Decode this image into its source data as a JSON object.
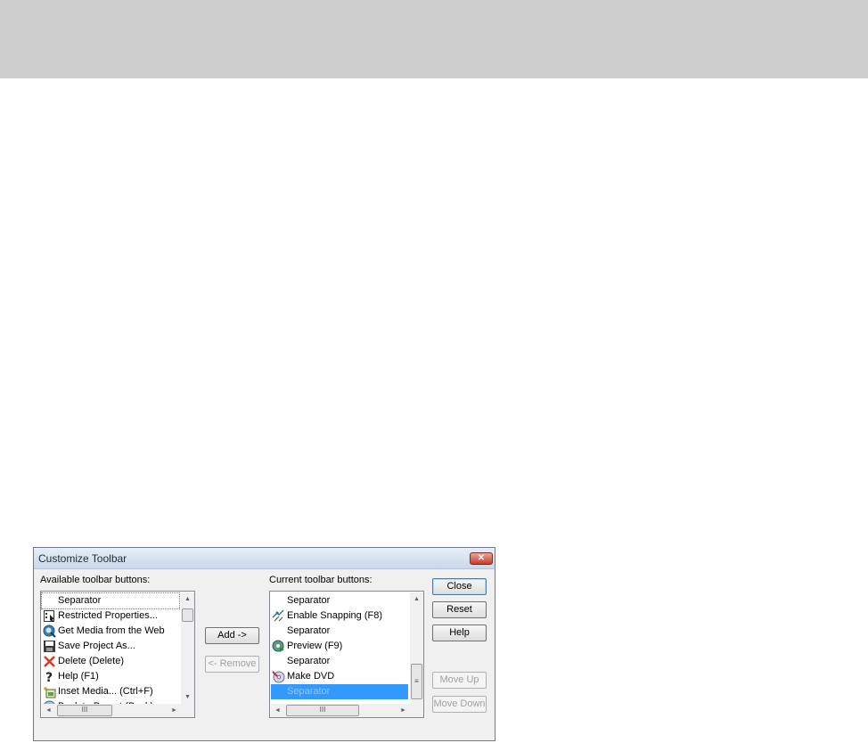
{
  "dialog": {
    "title": "Customize Toolbar",
    "close_glyph": "✕",
    "available_label": "Available toolbar buttons:",
    "current_label": "Current toolbar buttons:",
    "available_items": [
      {
        "label": "Separator",
        "icon": "none"
      },
      {
        "label": "Restricted Properties...",
        "icon": "properties-icon"
      },
      {
        "label": "Get Media from the Web",
        "icon": "web-media-icon"
      },
      {
        "label": "Save Project As...",
        "icon": "save-icon"
      },
      {
        "label": "Delete (Delete)",
        "icon": "delete-icon"
      },
      {
        "label": "Help (F1)",
        "icon": "help-icon"
      },
      {
        "label": "Inset Media... (Ctrl+F)",
        "icon": "insert-media-icon"
      },
      {
        "label": "Back to Parent (Back)",
        "icon": "back-to-parent-icon"
      }
    ],
    "current_items": [
      {
        "label": "Separator",
        "icon": "none"
      },
      {
        "label": "Enable Snapping (F8)",
        "icon": "snapping-icon"
      },
      {
        "label": "Separator",
        "icon": "none"
      },
      {
        "label": "Preview (F9)",
        "icon": "preview-icon"
      },
      {
        "label": "Separator",
        "icon": "none"
      },
      {
        "label": "Make DVD",
        "icon": "make-dvd-icon"
      },
      {
        "label": "Separator",
        "icon": "none"
      }
    ],
    "buttons": {
      "add": "Add ->",
      "remove": "<- Remove",
      "close": "Close",
      "reset": "Reset",
      "help": "Help",
      "move_up": "Move Up",
      "move_down": "Move Down"
    },
    "scroll_up": "▲",
    "scroll_down": "▼",
    "scroll_left": "◄",
    "scroll_right": "►",
    "thumb_grip": "III",
    "selected_color": "#3399ff"
  }
}
